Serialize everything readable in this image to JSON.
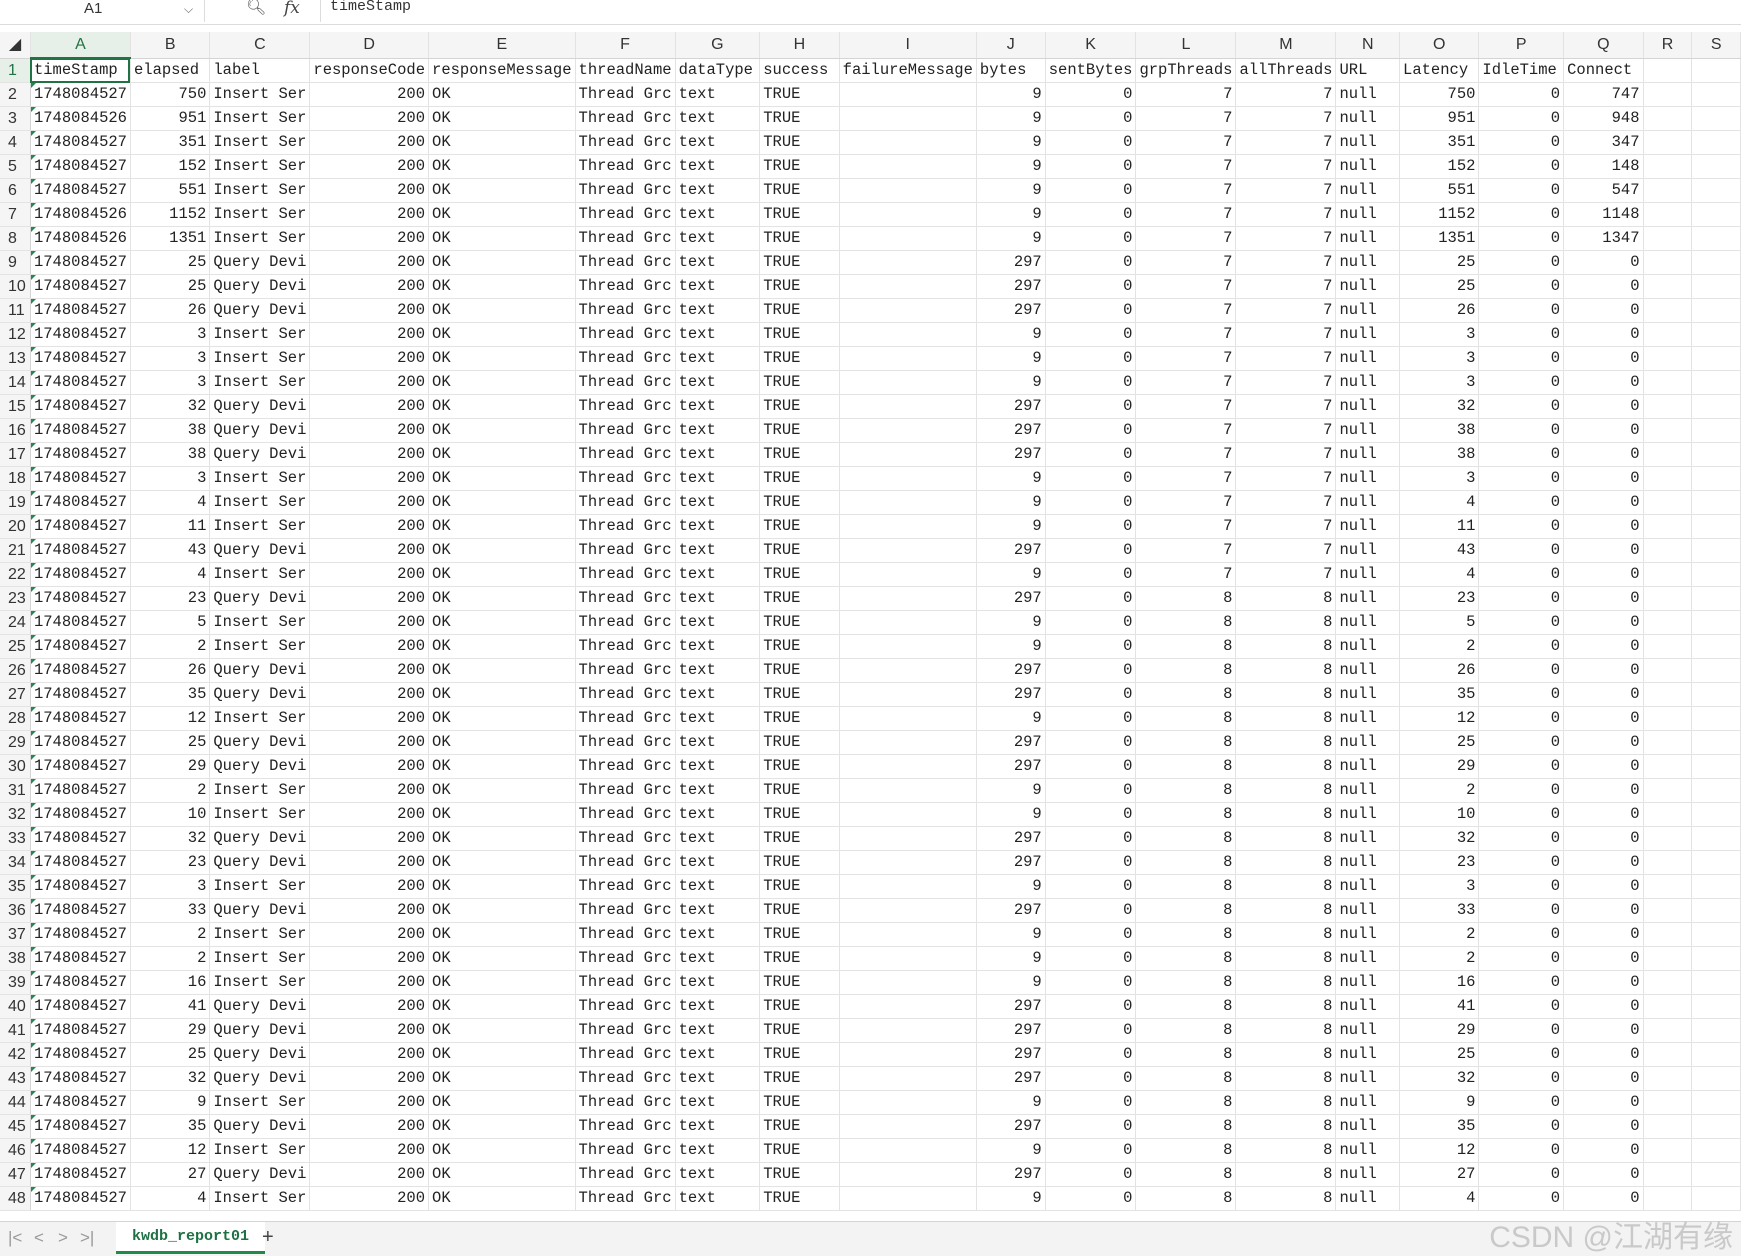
{
  "formula_bar": {
    "namebox": "A1",
    "zoom_icon": "search-zoom-icon",
    "fx_label": "fx",
    "content": "timeStamp"
  },
  "columns": [
    "A",
    "B",
    "C",
    "D",
    "E",
    "F",
    "G",
    "H",
    "I",
    "J",
    "K",
    "L",
    "M",
    "N",
    "O",
    "P",
    "Q",
    "R",
    "S"
  ],
  "headers": [
    "timeStamp",
    "elapsed",
    "label",
    "responseCode",
    "responseMessage",
    "threadName",
    "dataType",
    "success",
    "failureMessage",
    "bytes",
    "sentBytes",
    "grpThreads",
    "allThreads",
    "URL",
    "Latency",
    "IdleTime",
    "Connect"
  ],
  "rows": [
    [
      "1748084527",
      750,
      "Insert Ser",
      200,
      "OK",
      "Thread Grc",
      "text",
      "TRUE",
      "",
      9,
      0,
      7,
      7,
      "null",
      750,
      0,
      747
    ],
    [
      "1748084526",
      951,
      "Insert Ser",
      200,
      "OK",
      "Thread Grc",
      "text",
      "TRUE",
      "",
      9,
      0,
      7,
      7,
      "null",
      951,
      0,
      948
    ],
    [
      "1748084527",
      351,
      "Insert Ser",
      200,
      "OK",
      "Thread Grc",
      "text",
      "TRUE",
      "",
      9,
      0,
      7,
      7,
      "null",
      351,
      0,
      347
    ],
    [
      "1748084527",
      152,
      "Insert Ser",
      200,
      "OK",
      "Thread Grc",
      "text",
      "TRUE",
      "",
      9,
      0,
      7,
      7,
      "null",
      152,
      0,
      148
    ],
    [
      "1748084527",
      551,
      "Insert Ser",
      200,
      "OK",
      "Thread Grc",
      "text",
      "TRUE",
      "",
      9,
      0,
      7,
      7,
      "null",
      551,
      0,
      547
    ],
    [
      "1748084526",
      1152,
      "Insert Ser",
      200,
      "OK",
      "Thread Grc",
      "text",
      "TRUE",
      "",
      9,
      0,
      7,
      7,
      "null",
      1152,
      0,
      1148
    ],
    [
      "1748084526",
      1351,
      "Insert Ser",
      200,
      "OK",
      "Thread Grc",
      "text",
      "TRUE",
      "",
      9,
      0,
      7,
      7,
      "null",
      1351,
      0,
      1347
    ],
    [
      "1748084527",
      25,
      "Query Devi",
      200,
      "OK",
      "Thread Grc",
      "text",
      "TRUE",
      "",
      297,
      0,
      7,
      7,
      "null",
      25,
      0,
      0
    ],
    [
      "1748084527",
      25,
      "Query Devi",
      200,
      "OK",
      "Thread Grc",
      "text",
      "TRUE",
      "",
      297,
      0,
      7,
      7,
      "null",
      25,
      0,
      0
    ],
    [
      "1748084527",
      26,
      "Query Devi",
      200,
      "OK",
      "Thread Grc",
      "text",
      "TRUE",
      "",
      297,
      0,
      7,
      7,
      "null",
      26,
      0,
      0
    ],
    [
      "1748084527",
      3,
      "Insert Ser",
      200,
      "OK",
      "Thread Grc",
      "text",
      "TRUE",
      "",
      9,
      0,
      7,
      7,
      "null",
      3,
      0,
      0
    ],
    [
      "1748084527",
      3,
      "Insert Ser",
      200,
      "OK",
      "Thread Grc",
      "text",
      "TRUE",
      "",
      9,
      0,
      7,
      7,
      "null",
      3,
      0,
      0
    ],
    [
      "1748084527",
      3,
      "Insert Ser",
      200,
      "OK",
      "Thread Grc",
      "text",
      "TRUE",
      "",
      9,
      0,
      7,
      7,
      "null",
      3,
      0,
      0
    ],
    [
      "1748084527",
      32,
      "Query Devi",
      200,
      "OK",
      "Thread Grc",
      "text",
      "TRUE",
      "",
      297,
      0,
      7,
      7,
      "null",
      32,
      0,
      0
    ],
    [
      "1748084527",
      38,
      "Query Devi",
      200,
      "OK",
      "Thread Grc",
      "text",
      "TRUE",
      "",
      297,
      0,
      7,
      7,
      "null",
      38,
      0,
      0
    ],
    [
      "1748084527",
      38,
      "Query Devi",
      200,
      "OK",
      "Thread Grc",
      "text",
      "TRUE",
      "",
      297,
      0,
      7,
      7,
      "null",
      38,
      0,
      0
    ],
    [
      "1748084527",
      3,
      "Insert Ser",
      200,
      "OK",
      "Thread Grc",
      "text",
      "TRUE",
      "",
      9,
      0,
      7,
      7,
      "null",
      3,
      0,
      0
    ],
    [
      "1748084527",
      4,
      "Insert Ser",
      200,
      "OK",
      "Thread Grc",
      "text",
      "TRUE",
      "",
      9,
      0,
      7,
      7,
      "null",
      4,
      0,
      0
    ],
    [
      "1748084527",
      11,
      "Insert Ser",
      200,
      "OK",
      "Thread Grc",
      "text",
      "TRUE",
      "",
      9,
      0,
      7,
      7,
      "null",
      11,
      0,
      0
    ],
    [
      "1748084527",
      43,
      "Query Devi",
      200,
      "OK",
      "Thread Grc",
      "text",
      "TRUE",
      "",
      297,
      0,
      7,
      7,
      "null",
      43,
      0,
      0
    ],
    [
      "1748084527",
      4,
      "Insert Ser",
      200,
      "OK",
      "Thread Grc",
      "text",
      "TRUE",
      "",
      9,
      0,
      7,
      7,
      "null",
      4,
      0,
      0
    ],
    [
      "1748084527",
      23,
      "Query Devi",
      200,
      "OK",
      "Thread Grc",
      "text",
      "TRUE",
      "",
      297,
      0,
      8,
      8,
      "null",
      23,
      0,
      0
    ],
    [
      "1748084527",
      5,
      "Insert Ser",
      200,
      "OK",
      "Thread Grc",
      "text",
      "TRUE",
      "",
      9,
      0,
      8,
      8,
      "null",
      5,
      0,
      0
    ],
    [
      "1748084527",
      2,
      "Insert Ser",
      200,
      "OK",
      "Thread Grc",
      "text",
      "TRUE",
      "",
      9,
      0,
      8,
      8,
      "null",
      2,
      0,
      0
    ],
    [
      "1748084527",
      26,
      "Query Devi",
      200,
      "OK",
      "Thread Grc",
      "text",
      "TRUE",
      "",
      297,
      0,
      8,
      8,
      "null",
      26,
      0,
      0
    ],
    [
      "1748084527",
      35,
      "Query Devi",
      200,
      "OK",
      "Thread Grc",
      "text",
      "TRUE",
      "",
      297,
      0,
      8,
      8,
      "null",
      35,
      0,
      0
    ],
    [
      "1748084527",
      12,
      "Insert Ser",
      200,
      "OK",
      "Thread Grc",
      "text",
      "TRUE",
      "",
      9,
      0,
      8,
      8,
      "null",
      12,
      0,
      0
    ],
    [
      "1748084527",
      25,
      "Query Devi",
      200,
      "OK",
      "Thread Grc",
      "text",
      "TRUE",
      "",
      297,
      0,
      8,
      8,
      "null",
      25,
      0,
      0
    ],
    [
      "1748084527",
      29,
      "Query Devi",
      200,
      "OK",
      "Thread Grc",
      "text",
      "TRUE",
      "",
      297,
      0,
      8,
      8,
      "null",
      29,
      0,
      0
    ],
    [
      "1748084527",
      2,
      "Insert Ser",
      200,
      "OK",
      "Thread Grc",
      "text",
      "TRUE",
      "",
      9,
      0,
      8,
      8,
      "null",
      2,
      0,
      0
    ],
    [
      "1748084527",
      10,
      "Insert Ser",
      200,
      "OK",
      "Thread Grc",
      "text",
      "TRUE",
      "",
      9,
      0,
      8,
      8,
      "null",
      10,
      0,
      0
    ],
    [
      "1748084527",
      32,
      "Query Devi",
      200,
      "OK",
      "Thread Grc",
      "text",
      "TRUE",
      "",
      297,
      0,
      8,
      8,
      "null",
      32,
      0,
      0
    ],
    [
      "1748084527",
      23,
      "Query Devi",
      200,
      "OK",
      "Thread Grc",
      "text",
      "TRUE",
      "",
      297,
      0,
      8,
      8,
      "null",
      23,
      0,
      0
    ],
    [
      "1748084527",
      3,
      "Insert Ser",
      200,
      "OK",
      "Thread Grc",
      "text",
      "TRUE",
      "",
      9,
      0,
      8,
      8,
      "null",
      3,
      0,
      0
    ],
    [
      "1748084527",
      33,
      "Query Devi",
      200,
      "OK",
      "Thread Grc",
      "text",
      "TRUE",
      "",
      297,
      0,
      8,
      8,
      "null",
      33,
      0,
      0
    ],
    [
      "1748084527",
      2,
      "Insert Ser",
      200,
      "OK",
      "Thread Grc",
      "text",
      "TRUE",
      "",
      9,
      0,
      8,
      8,
      "null",
      2,
      0,
      0
    ],
    [
      "1748084527",
      2,
      "Insert Ser",
      200,
      "OK",
      "Thread Grc",
      "text",
      "TRUE",
      "",
      9,
      0,
      8,
      8,
      "null",
      2,
      0,
      0
    ],
    [
      "1748084527",
      16,
      "Insert Ser",
      200,
      "OK",
      "Thread Grc",
      "text",
      "TRUE",
      "",
      9,
      0,
      8,
      8,
      "null",
      16,
      0,
      0
    ],
    [
      "1748084527",
      41,
      "Query Devi",
      200,
      "OK",
      "Thread Grc",
      "text",
      "TRUE",
      "",
      297,
      0,
      8,
      8,
      "null",
      41,
      0,
      0
    ],
    [
      "1748084527",
      29,
      "Query Devi",
      200,
      "OK",
      "Thread Grc",
      "text",
      "TRUE",
      "",
      297,
      0,
      8,
      8,
      "null",
      29,
      0,
      0
    ],
    [
      "1748084527",
      25,
      "Query Devi",
      200,
      "OK",
      "Thread Grc",
      "text",
      "TRUE",
      "",
      297,
      0,
      8,
      8,
      "null",
      25,
      0,
      0
    ],
    [
      "1748084527",
      32,
      "Query Devi",
      200,
      "OK",
      "Thread Grc",
      "text",
      "TRUE",
      "",
      297,
      0,
      8,
      8,
      "null",
      32,
      0,
      0
    ],
    [
      "1748084527",
      9,
      "Insert Ser",
      200,
      "OK",
      "Thread Grc",
      "text",
      "TRUE",
      "",
      9,
      0,
      8,
      8,
      "null",
      9,
      0,
      0
    ],
    [
      "1748084527",
      35,
      "Query Devi",
      200,
      "OK",
      "Thread Grc",
      "text",
      "TRUE",
      "",
      297,
      0,
      8,
      8,
      "null",
      35,
      0,
      0
    ],
    [
      "1748084527",
      12,
      "Insert Ser",
      200,
      "OK",
      "Thread Grc",
      "text",
      "TRUE",
      "",
      9,
      0,
      8,
      8,
      "null",
      12,
      0,
      0
    ],
    [
      "1748084527",
      27,
      "Query Devi",
      200,
      "OK",
      "Thread Grc",
      "text",
      "TRUE",
      "",
      297,
      0,
      8,
      8,
      "null",
      27,
      0,
      0
    ],
    [
      "1748084527",
      4,
      "Insert Ser",
      200,
      "OK",
      "Thread Grc",
      "text",
      "TRUE",
      "",
      9,
      0,
      8,
      8,
      "null",
      4,
      0,
      0
    ]
  ],
  "sheet_bar": {
    "nav_first": "|<",
    "nav_prev": "<",
    "nav_next": ">",
    "nav_last": ">|",
    "active_sheet": "kwdb_report01",
    "add_sheet": "+"
  },
  "watermark": "CSDN @江湖有缘",
  "colors": {
    "accent": "#217346",
    "sheet_tab_text": "#1e7145",
    "header_bg": "#f5f5f5"
  }
}
